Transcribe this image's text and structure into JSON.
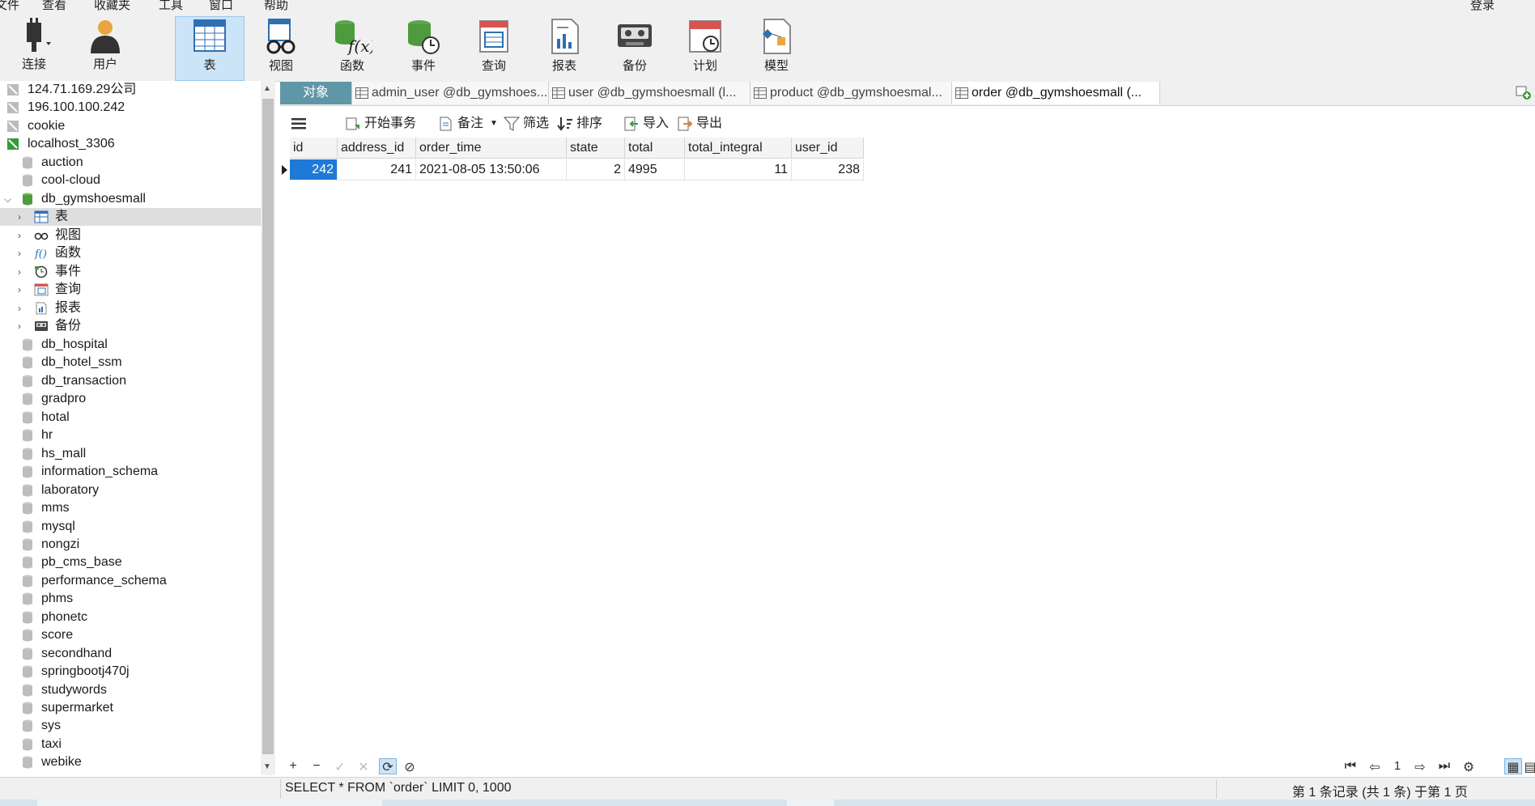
{
  "menu": {
    "items": [
      "文件",
      "查看",
      "收藏夹",
      "工具",
      "窗口",
      "帮助"
    ],
    "login": "登录"
  },
  "toolbar": {
    "buttons": [
      {
        "label": "连接",
        "icon": "plug-icon"
      },
      {
        "label": "用户",
        "icon": "user-icon"
      },
      {
        "label": "表",
        "icon": "table-icon"
      },
      {
        "label": "视图",
        "icon": "view-glasses-icon"
      },
      {
        "label": "函数",
        "icon": "function-icon"
      },
      {
        "label": "事件",
        "icon": "event-clock-icon"
      },
      {
        "label": "查询",
        "icon": "query-icon"
      },
      {
        "label": "报表",
        "icon": "report-icon"
      },
      {
        "label": "备份",
        "icon": "backup-icon"
      },
      {
        "label": "计划",
        "icon": "calendar-icon"
      },
      {
        "label": "模型",
        "icon": "model-icon"
      }
    ],
    "active": "表"
  },
  "tree": {
    "connections": [
      "124.71.169.29公司",
      "196.100.100.242",
      "cookie",
      "localhost_3306"
    ],
    "databases_before": [
      "auction",
      "cool-cloud"
    ],
    "open_db": "db_gymshoesmall",
    "children": [
      "表",
      "视图",
      "函数",
      "事件",
      "查询",
      "报表",
      "备份"
    ],
    "databases_after": [
      "db_hospital",
      "db_hotel_ssm",
      "db_transaction",
      "gradpro",
      "hotal",
      "hr",
      "hs_mall",
      "information_schema",
      "laboratory",
      "mms",
      "mysql",
      "nongzi",
      "pb_cms_base",
      "performance_schema",
      "phms",
      "phonetc",
      "score",
      "secondhand",
      "springbootj470j",
      "studywords",
      "supermarket",
      "sys",
      "taxi",
      "webike"
    ]
  },
  "tabs": [
    {
      "label": "对象"
    },
    {
      "label": "admin_user @db_gymshoes..."
    },
    {
      "label": "user @db_gymshoesmall (l..."
    },
    {
      "label": "product @db_gymshoesmal..."
    },
    {
      "label": "order @db_gymshoesmall (..."
    }
  ],
  "subtoolbar": {
    "begin_transaction": "开始事务",
    "note": "备注",
    "filter": "筛选",
    "sort": "排序",
    "import": "导入",
    "export": "导出"
  },
  "grid": {
    "columns": [
      "id",
      "address_id",
      "order_time",
      "state",
      "total",
      "total_integral",
      "user_id"
    ],
    "rows": [
      [
        "242",
        "241",
        "2021-08-05 13:50:06",
        "2",
        "4995",
        "11",
        "238"
      ]
    ]
  },
  "pager": {
    "page": "1"
  },
  "status": {
    "sql": "SELECT * FROM `order` LIMIT 0, 1000",
    "info": "第 1 条记录 (共 1 条) 于第 1 页"
  }
}
